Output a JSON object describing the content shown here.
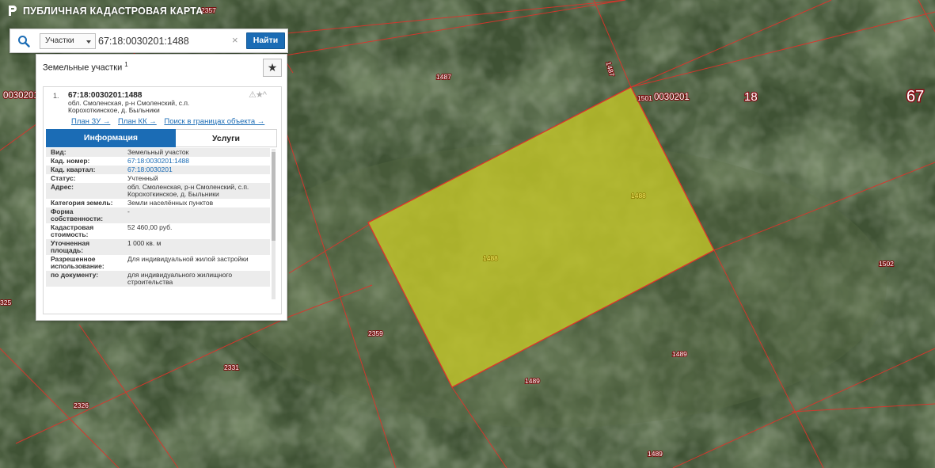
{
  "app": {
    "title": "ПУБЛИЧНАЯ КАДАСТРОВАЯ КАРТА"
  },
  "search": {
    "type_label": "Участки",
    "query": "67:18:0030201:1488",
    "clear_symbol": "×",
    "find_label": "Найти"
  },
  "panel": {
    "title": "Земельные участки",
    "count": "1",
    "fav_symbol": "★"
  },
  "result": {
    "index": "1.",
    "number": "67:18:0030201:1488",
    "address_line1": "обл. Смоленская, р-н Смоленский, с.п.",
    "address_line2": "Корохоткинское, д. Быльники",
    "icons": "⚠★^",
    "links": [
      "План ЗУ →",
      "План КК →",
      "Поиск в границах объекта →"
    ],
    "tabs": [
      "Информация",
      "Услуги"
    ]
  },
  "info": [
    {
      "key": "Вид:",
      "value": "Земельный участок"
    },
    {
      "key": "Кад. номер:",
      "value": "67:18:0030201:1488"
    },
    {
      "key": "Кад. квартал:",
      "value": "67:18:0030201"
    },
    {
      "key": "Статус:",
      "value": "Учтенный"
    },
    {
      "key": "Адрес:",
      "value": "обл. Смоленская, р-н Смоленский, с.п. Корохоткинское, д. Быльники"
    },
    {
      "key": "Категория земель:",
      "value": "Земли населённых пунктов"
    },
    {
      "key": "Форма собственности:",
      "value": "-"
    },
    {
      "key": "Кадастровая стоимость:",
      "value": "52 460,00 руб."
    },
    {
      "key": "Уточненная площадь:",
      "value": "1 000 кв. м"
    },
    {
      "key": "Разрешенное использование:",
      "value": "Для индивидуальной жилой застройки"
    },
    {
      "key": "по документу:",
      "value": "для индивидуального жилищного строительства"
    }
  ],
  "map": {
    "labels": {
      "l2357": "2357",
      "l1487a": "1487",
      "l1487b": "1487",
      "l1501": "1501",
      "l0030201a": "0030201",
      "l0030201b": "0030201",
      "l18": "18",
      "l67": "67",
      "l1488a": "1488",
      "l1488b": "1488",
      "l1502": "1502",
      "l325": "325",
      "l2359": "2359",
      "l2331": "2331",
      "l2326": "2326",
      "l1489a": "1489",
      "l1489b": "1489",
      "l1489c": "1489"
    },
    "colors": {
      "parcel_fill": "#c6c928",
      "boundary": "#e0322a",
      "label_red": "#b3001b"
    }
  }
}
